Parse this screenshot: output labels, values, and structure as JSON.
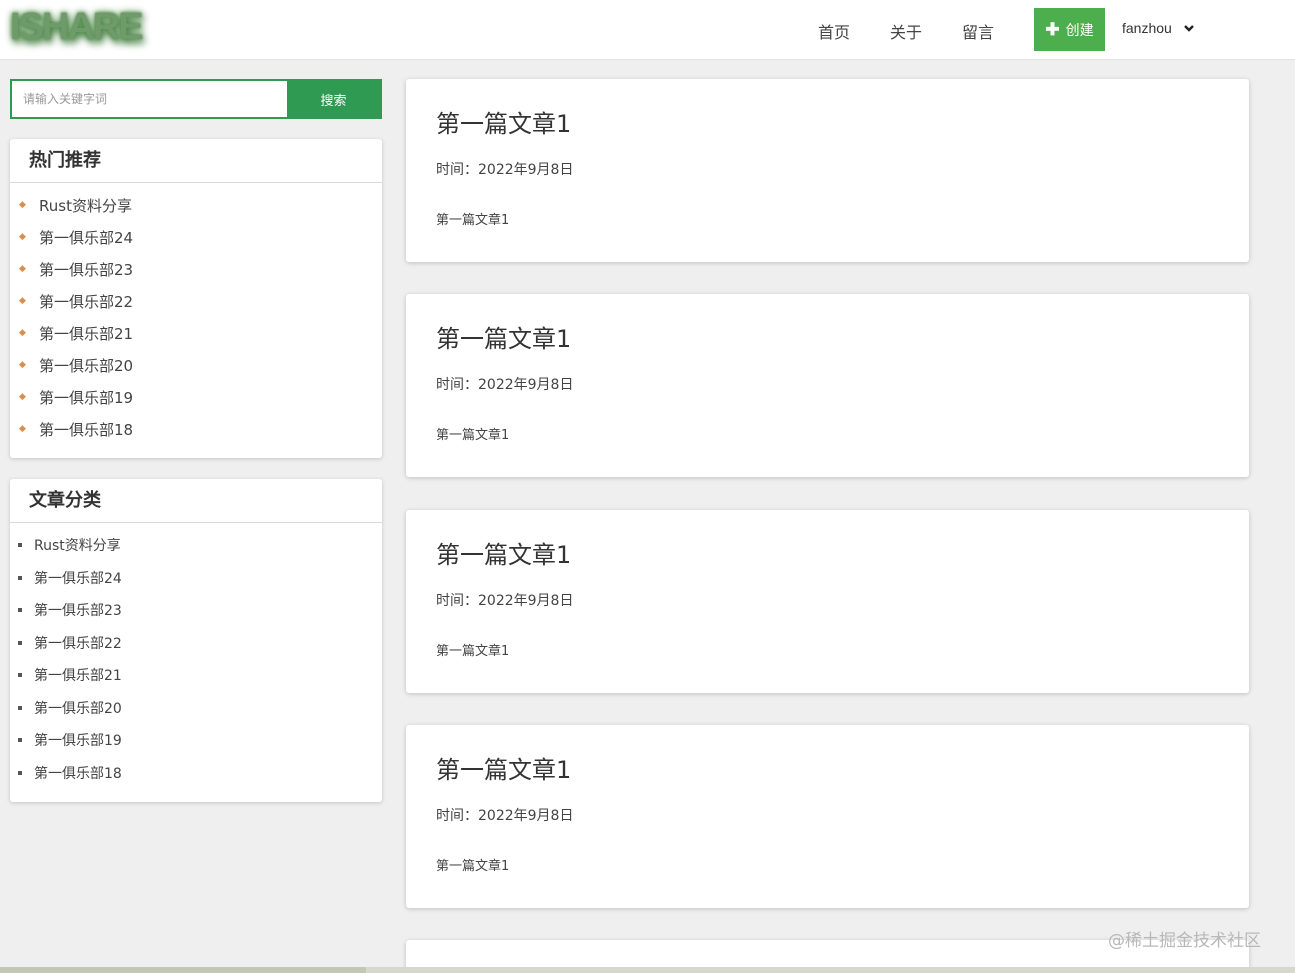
{
  "header": {
    "logo": "ISHARE",
    "nav": [
      "首页",
      "关于",
      "留言"
    ],
    "create_label": "创建",
    "username": "fanzhou"
  },
  "search": {
    "placeholder": "请输入关键字词",
    "button_label": "搜索"
  },
  "hot": {
    "title": "热门推荐",
    "items": [
      "Rust资料分享",
      "第一俱乐部24",
      "第一俱乐部23",
      "第一俱乐部22",
      "第一俱乐部21",
      "第一俱乐部20",
      "第一俱乐部19",
      "第一俱乐部18"
    ]
  },
  "categories": {
    "title": "文章分类",
    "items": [
      "Rust资料分享",
      "第一俱乐部24",
      "第一俱乐部23",
      "第一俱乐部22",
      "第一俱乐部21",
      "第一俱乐部20",
      "第一俱乐部19",
      "第一俱乐部18"
    ]
  },
  "articles": [
    {
      "title": "第一篇文章1",
      "time": "时间：2022年9月8日",
      "excerpt": "第一篇文章1"
    },
    {
      "title": "第一篇文章1",
      "time": "时间：2022年9月8日",
      "excerpt": "第一篇文章1"
    },
    {
      "title": "第一篇文章1",
      "time": "时间：2022年9月8日",
      "excerpt": "第一篇文章1"
    },
    {
      "title": "第一篇文章1",
      "time": "时间：2022年9月8日",
      "excerpt": "第一篇文章1"
    }
  ],
  "watermark": "@稀土掘金技术社区",
  "colors": {
    "accent": "#2f9a52",
    "create_button": "#4cae4c",
    "hot_bullet": "#e08a4a",
    "background": "#efefef"
  },
  "icons": {
    "create": "plus-icon",
    "user_menu": "chevron-down-icon",
    "hot_bullet": "diamond-bullet-icon",
    "category_bullet": "square-bullet-icon"
  }
}
